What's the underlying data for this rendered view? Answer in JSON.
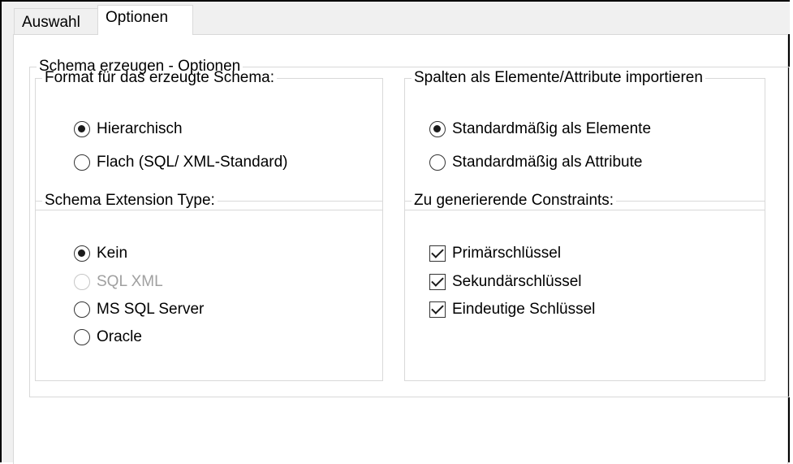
{
  "tabs": [
    {
      "label": "Auswahl",
      "active": false
    },
    {
      "label": "Optionen",
      "active": true
    }
  ],
  "options_group": {
    "title": "Schema erzeugen - Optionen",
    "format_group": {
      "title": "Format für das erzeugte Schema:",
      "options": [
        {
          "label": "Hierarchisch",
          "selected": true
        },
        {
          "label": "Flach (SQL/ XML-Standard)",
          "selected": false
        }
      ]
    },
    "columns_group": {
      "title": "Spalten als Elemente/Attribute importieren",
      "options": [
        {
          "label": "Standardmäßig als Elemente",
          "selected": true
        },
        {
          "label": "Standardmäßig als Attribute",
          "selected": false
        }
      ]
    },
    "extension_group": {
      "title": "Schema Extension Type:",
      "options": [
        {
          "label": "Kein",
          "selected": true,
          "enabled": true
        },
        {
          "label": "SQL XML",
          "selected": false,
          "enabled": false
        },
        {
          "label": "MS SQL Server",
          "selected": false,
          "enabled": true
        },
        {
          "label": "Oracle",
          "selected": false,
          "enabled": true
        }
      ]
    },
    "constraints_group": {
      "title": "Zu generierende Constraints:",
      "options": [
        {
          "label": "Primärschlüssel",
          "checked": true
        },
        {
          "label": "Sekundärschlüssel",
          "checked": true
        },
        {
          "label": "Eindeutige Schlüssel",
          "checked": true
        }
      ]
    }
  },
  "colors": {
    "border": "#d9d9d9",
    "disabled_text": "#a0a0a0",
    "window_bg": "#f0f0f0"
  }
}
